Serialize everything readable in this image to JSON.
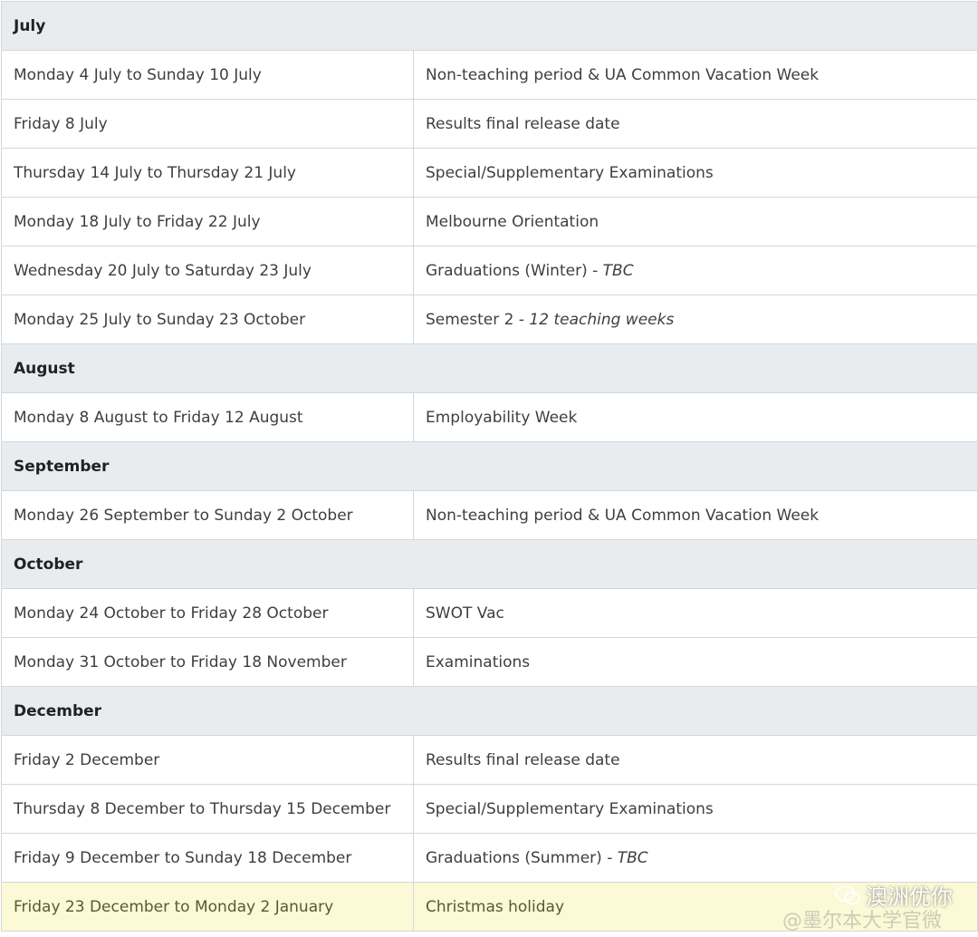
{
  "calendar": {
    "sections": [
      {
        "month": "July",
        "rows": [
          {
            "date": "Monday 4 July to Sunday 10 July",
            "event": "Non-teaching period & UA Common Vacation Week",
            "note": ""
          },
          {
            "date": "Friday 8 July",
            "event": "Results final release date",
            "note": ""
          },
          {
            "date": "Thursday 14 July to Thursday 21 July",
            "event": "Special/Supplementary Examinations",
            "note": ""
          },
          {
            "date": "Monday 18 July to Friday 22 July",
            "event": "Melbourne Orientation",
            "note": ""
          },
          {
            "date": "Wednesday 20 July to Saturday 23 July",
            "event": "Graduations (Winter) - ",
            "note": "TBC"
          },
          {
            "date": "Monday 25 July to Sunday 23 October",
            "event": "Semester 2 - ",
            "note": "12 teaching weeks"
          }
        ]
      },
      {
        "month": "August",
        "rows": [
          {
            "date": "Monday 8 August to Friday 12 August",
            "event": "Employability Week",
            "note": ""
          }
        ]
      },
      {
        "month": "September",
        "rows": [
          {
            "date": "Monday 26 September to Sunday 2 October",
            "event": "Non-teaching period & UA Common Vacation Week",
            "note": ""
          }
        ]
      },
      {
        "month": "October",
        "rows": [
          {
            "date": "Monday 24 October to Friday 28 October",
            "event": "SWOT Vac",
            "note": ""
          },
          {
            "date": "Monday 31 October to Friday 18 November",
            "event": "Examinations",
            "note": ""
          }
        ]
      },
      {
        "month": "December",
        "rows": [
          {
            "date": "Friday 2 December",
            "event": "Results final release date",
            "note": ""
          },
          {
            "date": "Thursday 8 December to Thursday 15 December",
            "event": "Special/Supplementary Examinations",
            "note": ""
          },
          {
            "date": "Friday 9 December to Sunday 18 December",
            "event": "Graduations (Summer) - ",
            "note": "TBC"
          },
          {
            "date": "Friday 23 December to Monday 2 January",
            "event": "Christmas holiday",
            "note": "",
            "highlight": true
          }
        ]
      }
    ]
  },
  "watermark": {
    "account": "澳洲优你",
    "faint_text": "@墨尔本大学官微"
  },
  "colors": {
    "month_row_bg": "#e9ecef",
    "highlight_row_bg": "#fbf9d6",
    "border": "#d3d7dc",
    "text": "#3c3f42"
  }
}
